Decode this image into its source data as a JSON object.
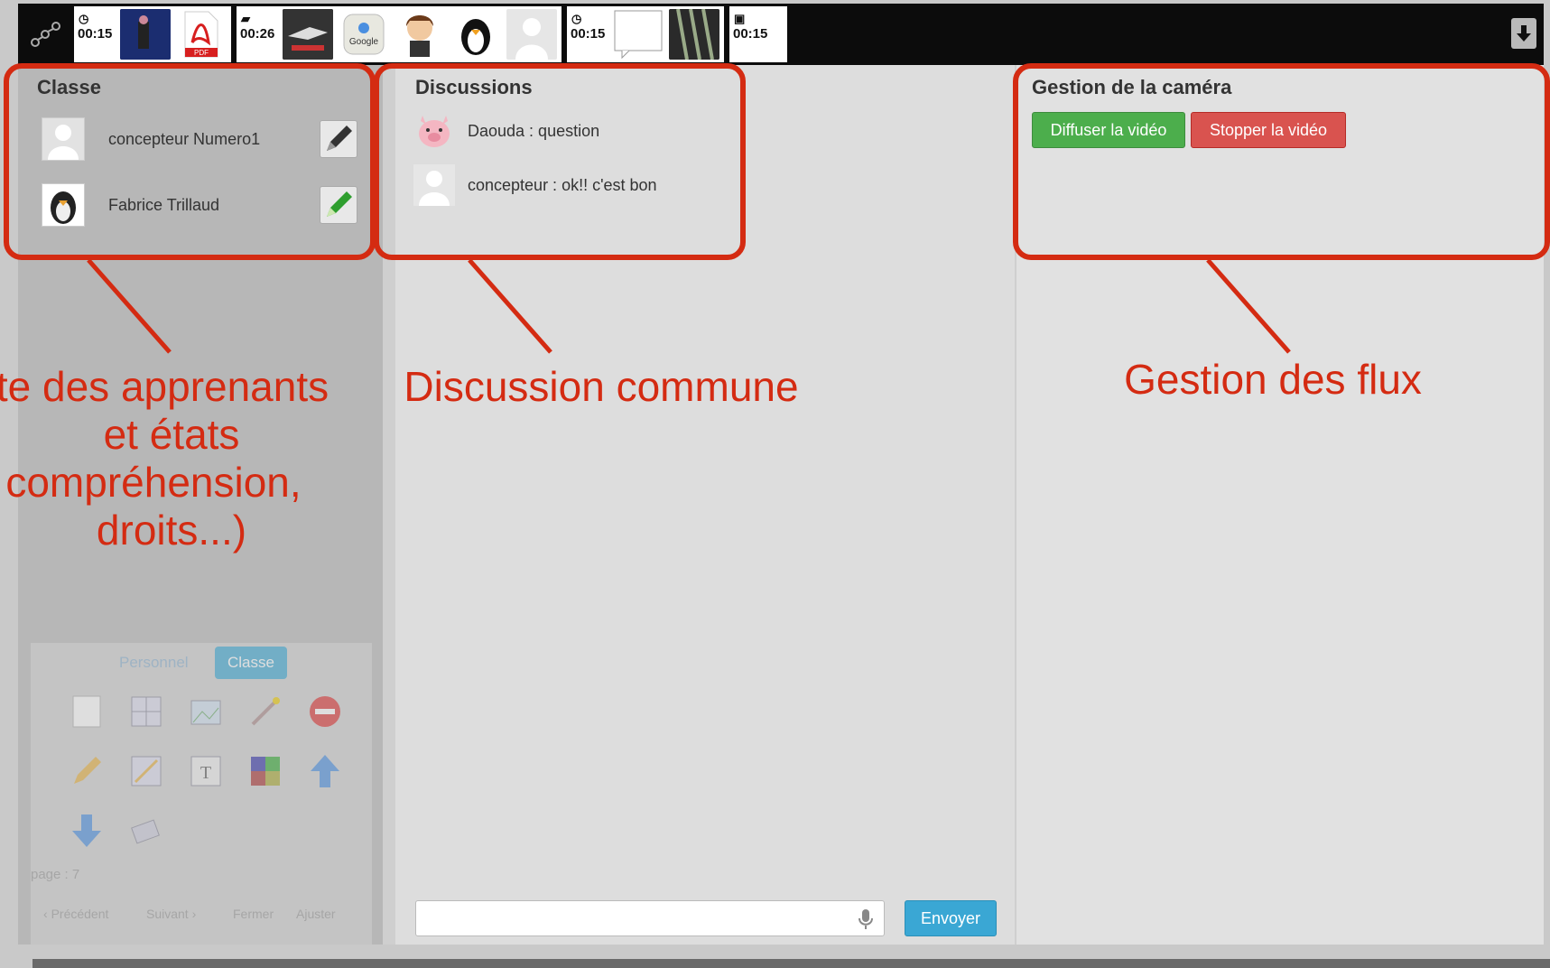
{
  "toolbar": {
    "groups": [
      {
        "time": "00:15",
        "icon": "clock-icon"
      },
      {
        "time": "00:26",
        "icon": "chat-icon"
      },
      {
        "time": "00:15",
        "icon": "clock-icon"
      },
      {
        "time": "00:15",
        "icon": "image-icon"
      }
    ],
    "pdf_label": "PDF",
    "google_label": "Google"
  },
  "classe": {
    "title": "Classe",
    "students": [
      {
        "name": "concepteur Numero1",
        "pencil_color": "#333333"
      },
      {
        "name": "Fabrice Trillaud",
        "pencil_color": "#2e9e2e"
      }
    ]
  },
  "discussions": {
    "title": "Discussions",
    "messages": [
      {
        "text": "Daouda : question"
      },
      {
        "text": "concepteur : ok!! c'est bon"
      }
    ],
    "input_placeholder": "",
    "send_label": "Envoyer"
  },
  "camera": {
    "title": "Gestion de la caméra",
    "start_label": "Diffuser la vidéo",
    "stop_label": "Stopper la vidéo"
  },
  "toolbox": {
    "tab_personnel": "Personnel",
    "tab_classe": "Classe",
    "page_label": "page : 7",
    "prev_label": "Précédent",
    "next_label": "Suivant",
    "close_label": "Fermer",
    "adjust_label": "Ajuster"
  },
  "annotations": {
    "left_lines": [
      "te des apprenants",
      "et états",
      "compréhension,",
      "droits...)"
    ],
    "middle": "Discussion commune",
    "right": "Gestion des flux",
    "color": "#d42b12"
  }
}
